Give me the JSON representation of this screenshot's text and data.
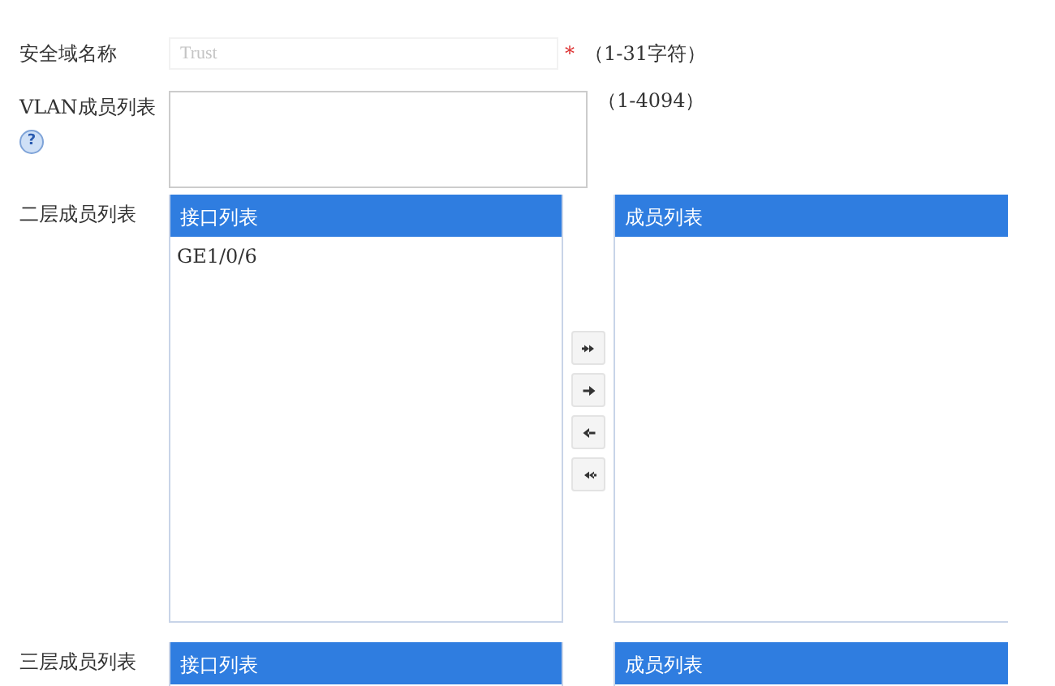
{
  "zone_name": {
    "label": "安全域名称",
    "placeholder": "Trust",
    "required_mark": "*",
    "hint": "（1-31字符）"
  },
  "vlan_members": {
    "label": "VLAN成员列表",
    "help": "?",
    "hint": "（1-4094）"
  },
  "member_groups": [
    {
      "label": "二层成员列表",
      "left": {
        "title": "接口列表",
        "items": [
          "GE1/0/6"
        ]
      },
      "right": {
        "title": "成员列表"
      },
      "transfer_buttons": [
        {
          "kind": "add_all"
        },
        {
          "kind": "add"
        },
        {
          "kind": "remove"
        },
        {
          "kind": "remove_all"
        }
      ]
    },
    {
      "label": "三层成员列表",
      "left": {
        "title": "接口列表"
      },
      "right": {
        "title": "成员列表"
      }
    }
  ]
}
